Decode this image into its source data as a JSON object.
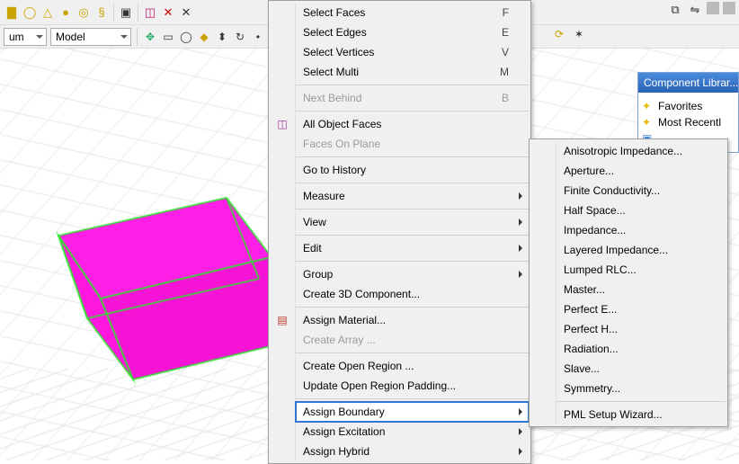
{
  "toolbar2": {
    "unit_label": "um",
    "mode_label": "Model"
  },
  "panel": {
    "title": "Component Librar...",
    "favorites": "Favorites",
    "recent": "Most Recentl"
  },
  "menu1": {
    "select_faces": {
      "label": "Select Faces",
      "shortcut": "F"
    },
    "select_edges": {
      "label": "Select Edges",
      "shortcut": "E"
    },
    "select_vertices": {
      "label": "Select Vertices",
      "shortcut": "V"
    },
    "select_multi": {
      "label": "Select Multi",
      "shortcut": "M"
    },
    "next_behind": {
      "label": "Next Behind",
      "shortcut": "B"
    },
    "all_object_faces": "All Object Faces",
    "faces_on_plane": "Faces On Plane",
    "go_to_history": "Go to History",
    "measure": "Measure",
    "view": "View",
    "edit": "Edit",
    "group": "Group",
    "create_3d_component": "Create 3D Component...",
    "assign_material": "Assign Material...",
    "create_array": "Create Array ...",
    "create_open_region": "Create Open Region ...",
    "update_open_region": "Update Open Region Padding...",
    "assign_boundary": "Assign Boundary",
    "assign_excitation": "Assign Excitation",
    "assign_hybrid": "Assign Hybrid"
  },
  "menu2": {
    "anisotropic_impedance": "Anisotropic Impedance...",
    "aperture": "Aperture...",
    "finite_conductivity": "Finite Conductivity...",
    "half_space": "Half Space...",
    "impedance": "Impedance...",
    "layered_impedance": "Layered Impedance...",
    "lumped_rlc": "Lumped RLC...",
    "master": "Master...",
    "perfect_e": "Perfect E...",
    "perfect_h": "Perfect H...",
    "radiation": "Radiation...",
    "slave": "Slave...",
    "symmetry": "Symmetry...",
    "pml_setup": "PML Setup Wizard..."
  }
}
